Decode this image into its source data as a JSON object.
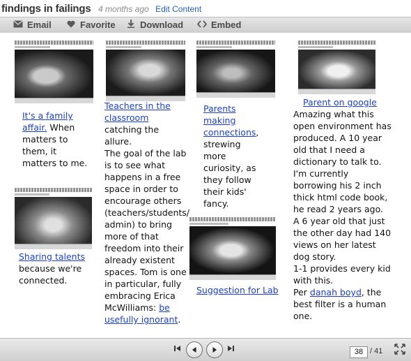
{
  "header": {
    "title": "findings in failings",
    "time_ago": "4 months ago",
    "edit_label": "Edit Content"
  },
  "toolbar": {
    "email_label": "Email",
    "favorite_label": "Favorite",
    "download_label": "Download",
    "embed_label": "Embed"
  },
  "slide": {
    "col1": {
      "link1": "It's a family affair.",
      "text1": "When matters to them, it matters to me.",
      "link2": "Sharing talents",
      "text2": "because we're connected."
    },
    "col2": {
      "link1": "Teachers in the classroom",
      "text1": "catching the allure.",
      "text2": "The goal of the lab is to see what happens in a free space in order to encourage others (teachers/students/ admin) to bring more of that freedom into their already existent spaces. Tom is one in particular, fully embracing Erica McWilliams:",
      "link2": "be usefully ignorant",
      "text3": "."
    },
    "col3": {
      "link1": "Parents making connections",
      "text1": ", strewing more curiosity, as they follow their kids' fancy.",
      "link2": "Suggestion for Lab"
    },
    "col4": {
      "link1": "Parent on google",
      "text1": "Amazing what this open environment has produced. A 10 year old that I need a dictionary to talk to. I'm currently borrowing his 2 inch thick html code book, he read 2 years ago.",
      "text2": "A 6 year old that just the other day had 140 views on her latest dog story.",
      "text3": "1-1 provides every kid with this.",
      "text4": "Per",
      "link2": "danah boyd",
      "text5": ", the best filter is a human one."
    }
  },
  "nav": {
    "current_page": "38",
    "total_pages": "/ 41"
  },
  "icons": {
    "email": "envelope-icon",
    "favorite": "heart-icon",
    "download": "download-arrow-icon",
    "embed": "code-brackets-icon",
    "first": "skip-first-icon",
    "prev": "previous-icon",
    "next": "next-icon",
    "last": "skip-last-icon",
    "fullscreen": "fullscreen-icon"
  }
}
